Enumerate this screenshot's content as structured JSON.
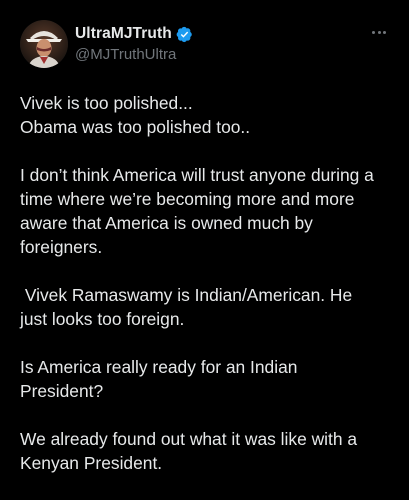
{
  "author": {
    "display_name": "UltraMJTruth",
    "handle": "@MJTruthUltra",
    "verified_icon": "verified-badge-icon",
    "badge_color": "#1d9bf0"
  },
  "more_icon": "more-horizontal-icon",
  "tweet": {
    "paragraphs": [
      [
        "Vivek is too polished...",
        "Obama was too polished too.."
      ],
      [
        "I don’t think America will trust anyone during a",
        "time where we’re becoming more and more",
        "aware that America is owned much by",
        "foreigners."
      ],
      [
        " Vivek Ramaswamy is Indian/American. He",
        "just looks too foreign."
      ],
      [
        "Is America really ready for an Indian",
        "President?"
      ],
      [
        "We already found out what it was like with a",
        "Kenyan President."
      ]
    ]
  },
  "colors": {
    "background": "#000000",
    "text": "#e7e9ea",
    "secondary": "#71767b"
  }
}
